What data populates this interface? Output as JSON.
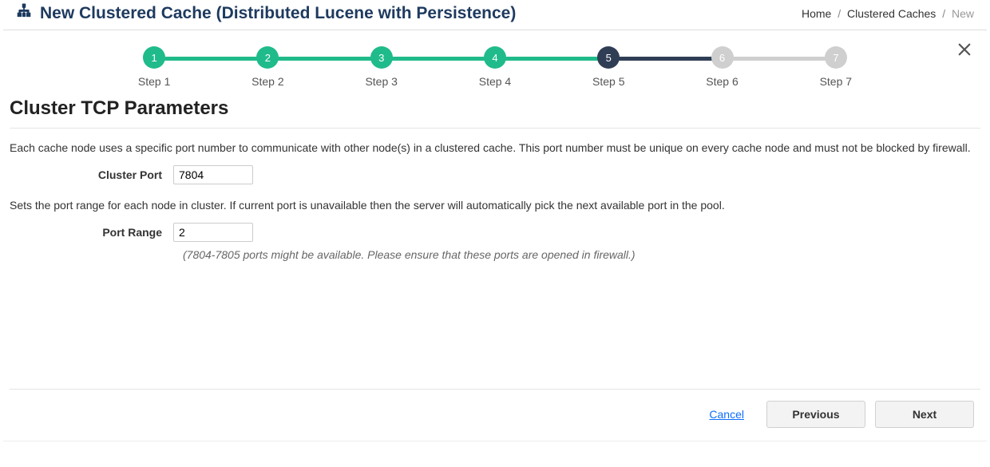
{
  "header": {
    "title": "New Clustered Cache (Distributed Lucene with Persistence)"
  },
  "breadcrumb": {
    "home": "Home",
    "mid": "Clustered Caches",
    "current": "New"
  },
  "stepper": {
    "steps": [
      {
        "num": "1",
        "label": "Step 1",
        "state": "done"
      },
      {
        "num": "2",
        "label": "Step 2",
        "state": "done"
      },
      {
        "num": "3",
        "label": "Step 3",
        "state": "done"
      },
      {
        "num": "4",
        "label": "Step 4",
        "state": "done"
      },
      {
        "num": "5",
        "label": "Step 5",
        "state": "active"
      },
      {
        "num": "6",
        "label": "Step 6",
        "state": "future"
      },
      {
        "num": "7",
        "label": "Step 7",
        "state": "future"
      }
    ]
  },
  "section": {
    "title": "Cluster TCP Parameters",
    "desc1": "Each cache node uses a specific port number to communicate with other node(s) in a clustered cache. This port number must be unique on every cache node and must not be blocked by firewall.",
    "cluster_port_label": "Cluster Port",
    "cluster_port_value": "7804",
    "desc2": "Sets the port range for each node in cluster. If current port is unavailable then the server will automatically pick the next available port in the pool.",
    "port_range_label": "Port Range",
    "port_range_value": "2",
    "hint": "(7804-7805 ports might be available. Please ensure that these ports are opened in firewall.)"
  },
  "footer": {
    "cancel": "Cancel",
    "previous": "Previous",
    "next": "Next"
  }
}
